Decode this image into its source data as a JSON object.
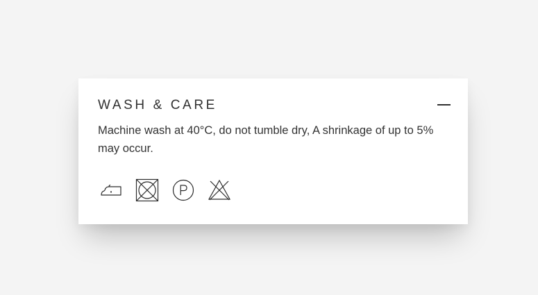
{
  "section": {
    "title": "WASH & CARE",
    "collapse_symbol": "—",
    "description": "Machine wash at 40°C, do not tumble dry, A shrinkage of up to 5% may occur."
  },
  "care_icons": [
    {
      "icon": "iron-low-heat-icon"
    },
    {
      "icon": "do-not-tumble-dry-icon"
    },
    {
      "icon": "dry-clean-p-icon"
    },
    {
      "icon": "do-not-bleach-icon"
    }
  ],
  "colors": {
    "background": "#f4f4f4",
    "card": "#ffffff",
    "text": "#2f2f2f"
  }
}
